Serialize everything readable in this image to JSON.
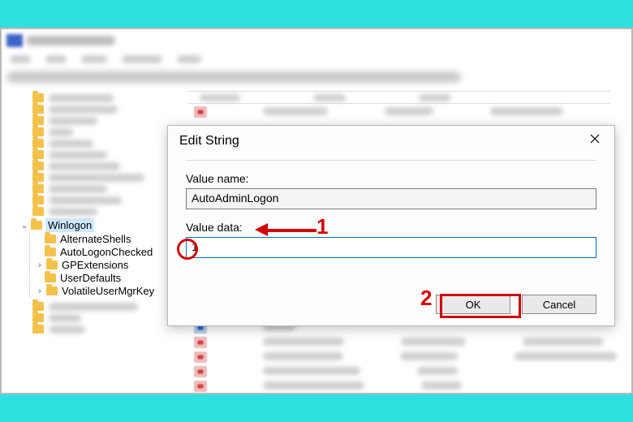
{
  "tree": {
    "selected": "Winlogon",
    "children": [
      "AlternateShells",
      "AutoLogonChecked",
      "GPExtensions",
      "UserDefaults",
      "VolatileUserMgrKey"
    ]
  },
  "dialog": {
    "title": "Edit String",
    "value_name_label": "Value name:",
    "value_name": "AutoAdminLogon",
    "value_data_label": "Value data:",
    "value_data": "1",
    "ok": "OK",
    "cancel": "Cancel"
  },
  "annotations": {
    "one": "1",
    "two": "2"
  }
}
